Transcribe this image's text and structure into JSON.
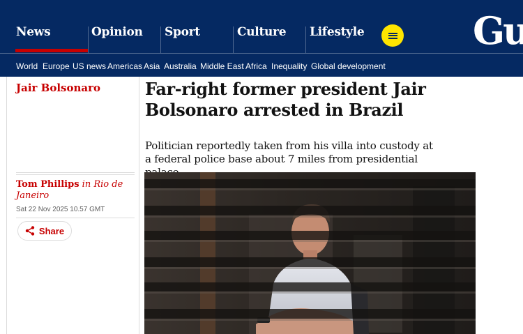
{
  "nav": {
    "pillars": [
      "News",
      "Opinion",
      "Sport",
      "Culture",
      "Lifestyle"
    ],
    "menu_icon": "hamburger-menu-icon",
    "logo_text": "Gu",
    "subnav": [
      "World",
      "Europe",
      "US news",
      "Americas",
      "Asia",
      "Australia",
      "Middle East",
      "Africa",
      "Inequality",
      "Global development"
    ]
  },
  "article": {
    "section": "Jair Bolsonaro",
    "headline": "Far-right former president Jair Bolsonaro arrested in Brazil",
    "standfirst": "Politician reportedly taken from his villa into custody at a federal police base about 7 miles from presidential palace",
    "author": "Tom Phillips",
    "location_prefix": "in",
    "location": "Rio de Janeiro",
    "date": "Sat 22 Nov 2025 10.57 GMT",
    "share_label": "Share",
    "share_icon": "share-icon"
  },
  "colors": {
    "nav_bg": "#052962",
    "accent_red": "#c70000",
    "menu_yellow": "#ffe500",
    "text": "#121212"
  }
}
